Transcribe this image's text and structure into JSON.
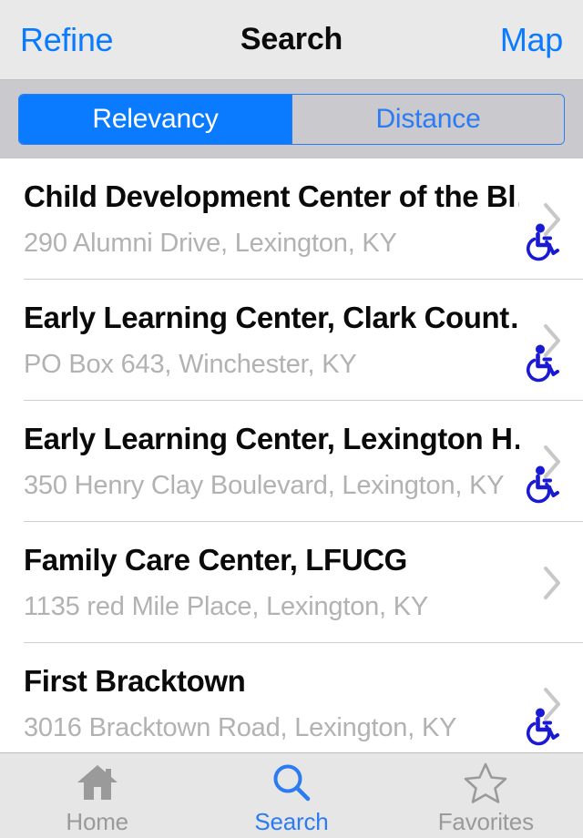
{
  "navbar": {
    "left_button": "Refine",
    "title": "Search",
    "right_button": "Map"
  },
  "segmented_control": {
    "options": [
      "Relevancy",
      "Distance"
    ],
    "selected": "Relevancy",
    "selected_bg": "#0a7bff",
    "selected_text": "#ffffff",
    "unselected_bg": "#c9c9ce",
    "unselected_text": "#2b7bf3"
  },
  "results": [
    {
      "name": "Child Development Center of the Bl…",
      "address": "290 Alumni Drive, Lexington, KY",
      "accessible": true
    },
    {
      "name": "Early Learning Center, Clark Count…",
      "address": "PO Box 643, Winchester, KY",
      "accessible": true
    },
    {
      "name": "Early Learning Center, Lexington H…",
      "address": "350 Henry Clay Boulevard, Lexington, KY",
      "accessible": true
    },
    {
      "name": "Family Care Center, LFUCG",
      "address": "1135 red Mile Place, Lexington, KY",
      "accessible": false
    },
    {
      "name": "First Bracktown",
      "address": "3016 Bracktown Road, Lexington, KY",
      "accessible": true
    }
  ],
  "icons": {
    "disclosure": "chevron-right-icon",
    "accessibility": "wheelchair-accessible-icon",
    "accessibility_color": "#1a1ad2",
    "disclosure_color": "#c8c8c8"
  },
  "tabbar": {
    "tabs": [
      {
        "label": "Home",
        "icon": "home-icon",
        "active": false
      },
      {
        "label": "Search",
        "icon": "search-icon",
        "active": true
      },
      {
        "label": "Favorites",
        "icon": "star-icon",
        "active": false
      }
    ],
    "active_color": "#2b7bf3",
    "inactive_color": "#9a9a9a"
  }
}
